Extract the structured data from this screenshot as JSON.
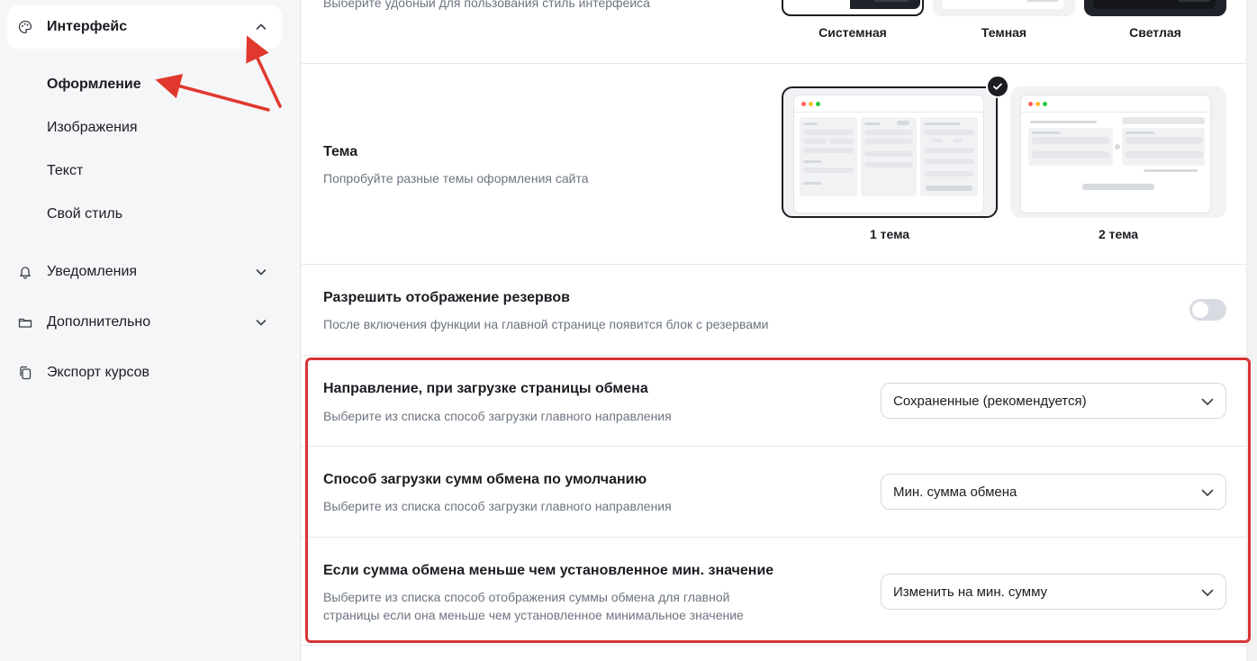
{
  "sidebar": {
    "group_label": "Интерфейс",
    "sub_items": [
      {
        "label": "Оформление",
        "active": true
      },
      {
        "label": "Изображения",
        "active": false
      },
      {
        "label": "Текст",
        "active": false
      },
      {
        "label": "Свой стиль",
        "active": false
      }
    ],
    "items": [
      {
        "label": "Уведомления",
        "icon": "bell-icon"
      },
      {
        "label": "Дополнительно",
        "icon": "folder-icon"
      },
      {
        "label": "Экспорт курсов",
        "icon": "copy-icon"
      }
    ]
  },
  "mode_section": {
    "desc": "Выберите удобный для пользования стиль интерфейса",
    "options": [
      "Системная",
      "Темная",
      "Светлая"
    ]
  },
  "theme_section": {
    "title": "Тема",
    "desc": "Попробуйте разные темы оформления сайта",
    "options": [
      "1 тема",
      "2 тема"
    ],
    "selected": "1 тема"
  },
  "reserves_section": {
    "title": "Разрешить отображение резервов",
    "desc": "После включения функции на главной странице появится блок с резервами",
    "enabled": false
  },
  "direction_section": {
    "title": "Направление, при загрузке страницы обмена",
    "desc": "Выберите из списка способ загрузки главного направления",
    "value": "Сохраненные (рекомендуется)"
  },
  "amount_section": {
    "title": "Способ загрузки сумм обмена по умолчанию",
    "desc": "Выберите из списка способ загрузки главного направления",
    "value": "Мин. сумма обмена"
  },
  "min_section": {
    "title": "Если сумма обмена меньше чем установленное мин. значение",
    "desc_line1": "Выберите из списка способ отображения суммы обмена для главной",
    "desc_line2": "страницы если она меньше чем установленное минимальное значение",
    "value": "Изменить на мин. сумму"
  },
  "colors": {
    "accent_dark": "#1b1d22",
    "highlight": "#d93434",
    "annotation_arrow": "#e0382f"
  }
}
